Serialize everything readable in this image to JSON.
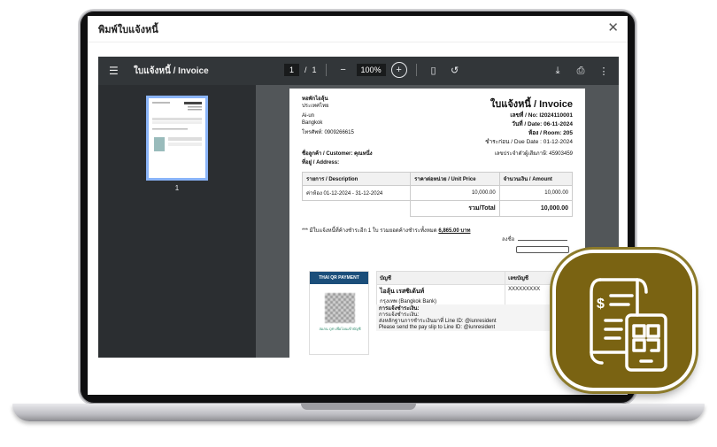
{
  "dialog": {
    "title": "พิมพ์ใบแจ้งหนี้"
  },
  "viewer": {
    "doc_title": "ใบแจ้งหนี้ / Invoice",
    "page_current": "1",
    "page_sep": "/",
    "page_total": "1",
    "zoom": "100%",
    "thumb_number": "1"
  },
  "invoice": {
    "dorm_name": "หอพักไอลุ้น",
    "country": "ประเทศไทย",
    "address_line": "Ai-un",
    "city": "Bangkok",
    "phone": "โทรศัพท์: 0909266615",
    "title": "ใบแจ้งหนี้ / Invoice",
    "no": "เลขที่ / No: I2024110001",
    "date": "วันที่ / Date: 06-11-2024",
    "room": "ห้อง / Room: 205",
    "due": "ชำระก่อน / Due Date : 01-12-2024",
    "customer": "ชื่อลูกค้า / Customer: คุณหนึ่ง",
    "address": "ที่อยู่ / Address:",
    "tax": "เลขประจำตัวผู้เสียภาษี: 45903459",
    "col_desc": "รายการ / Description",
    "col_unit": "ราคาต่อหน่วย / Unit Price",
    "col_amount": "จำนวนเงิน / Amount",
    "row_desc": "ค่าห้อง 01-12-2024 - 31-12-2024",
    "row_unit": "10,000.00",
    "row_amount": "10,000.00",
    "total_label": "รวม/Total",
    "total_value": "10,000.00",
    "note": "*** มีใบแจ้งหนี้ที่ค้างชำระอีก 1 ใบ รวมยอดค้างชำระทั้งหมด",
    "note_amount": "6,865.00 บาท",
    "sign_label": "ลงชื่อ"
  },
  "payment": {
    "qr_header": "THAI QR PAYMENT",
    "qr_caption": "สแกน QR เพื่อโอนเข้าบัญชี",
    "col_account": "บัญชี",
    "col_number": "เลขบัญชี",
    "account_name": "ไอลุ้น เรสซิเด้นท์",
    "bank": "กรุงเทพ (Bangkok Bank)",
    "account_number": "XXXXXXXXX",
    "channel_title": "การแจ้งชำระเงิน:",
    "channel_l1": "การแจ้งชำระเงิน:",
    "channel_l2": "ส่งหลักฐานการชำระเงินมาที่ Line ID: @iunresident",
    "channel_l3": "Please send the pay slip to Line ID: @iunresident"
  }
}
